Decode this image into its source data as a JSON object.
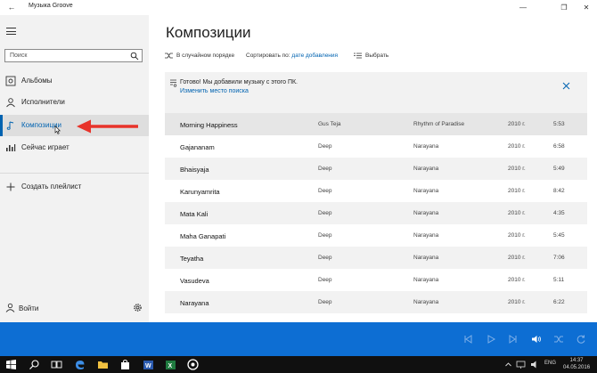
{
  "window": {
    "title": "Музыка Groove"
  },
  "sidebar": {
    "search_placeholder": "Поиск",
    "items": [
      {
        "label": "Альбомы",
        "icon": "album-icon"
      },
      {
        "label": "Исполнители",
        "icon": "artist-icon"
      },
      {
        "label": "Композиции",
        "icon": "music-note-icon",
        "active": true
      },
      {
        "label": "Сейчас играет",
        "icon": "now-playing-icon"
      },
      {
        "label": "Создать плейлист",
        "icon": "plus-icon"
      }
    ],
    "signin_label": "Войти"
  },
  "main": {
    "title": "Композиции",
    "toolbar": {
      "shuffle_label": "В случайном порядке",
      "sort_label": "Сортировать по:",
      "sort_value": "дате добавления",
      "select_label": "Выбрать"
    },
    "notice": {
      "message": "Готово! Мы добавили музыку с этого ПК.",
      "link": "Изменить место поиска"
    },
    "songs": [
      {
        "title": "Morning Happiness",
        "artist": "Gus Teja",
        "album": "Rhythm of Paradise",
        "year": "2010 г.",
        "duration": "5:53"
      },
      {
        "title": "Gajananam",
        "artist": "Deep",
        "album": "Narayana",
        "year": "2010 г.",
        "duration": "6:58"
      },
      {
        "title": "Bhaisyaja",
        "artist": "Deep",
        "album": "Narayana",
        "year": "2010 г.",
        "duration": "5:49"
      },
      {
        "title": "Karunyamrita",
        "artist": "Deep",
        "album": "Narayana",
        "year": "2010 г.",
        "duration": "8:42"
      },
      {
        "title": "Mata Kali",
        "artist": "Deep",
        "album": "Narayana",
        "year": "2010 г.",
        "duration": "4:35"
      },
      {
        "title": "Maha Ganapati",
        "artist": "Deep",
        "album": "Narayana",
        "year": "2010 г.",
        "duration": "5:45"
      },
      {
        "title": "Teyatha",
        "artist": "Deep",
        "album": "Narayana",
        "year": "2010 г.",
        "duration": "7:06"
      },
      {
        "title": "Vasudeva",
        "artist": "Deep",
        "album": "Narayana",
        "year": "2010 г.",
        "duration": "5:11"
      },
      {
        "title": "Narayana",
        "artist": "Deep",
        "album": "Narayana",
        "year": "2010 г.",
        "duration": "6:22"
      }
    ]
  },
  "taskbar": {
    "language": "ENG",
    "time": "14:37",
    "date": "04.05.2016"
  },
  "colors": {
    "accent": "#0063b1",
    "player": "#0d6ed3",
    "annotation_arrow": "#e8332a"
  }
}
